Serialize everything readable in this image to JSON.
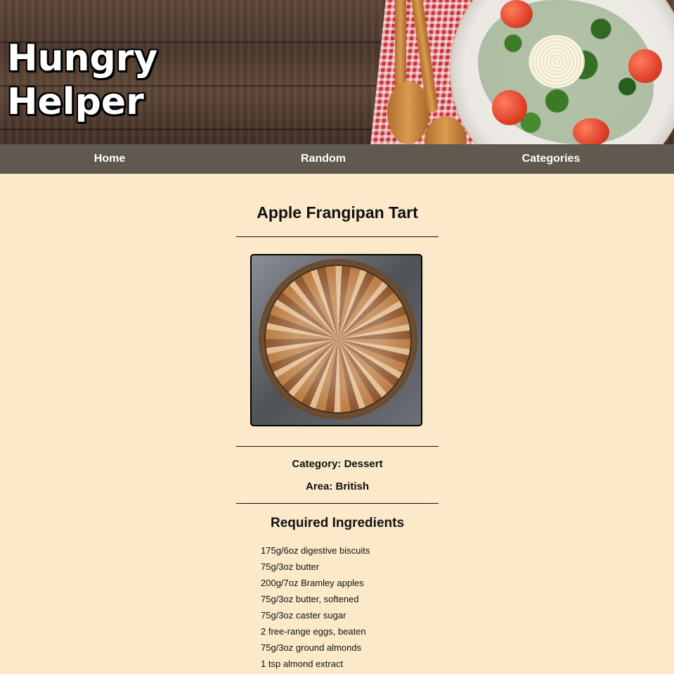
{
  "brand": {
    "line1": "Hungry",
    "line2": "Helper"
  },
  "nav": {
    "home": "Home",
    "random": "Random",
    "categories": "Categories"
  },
  "recipe": {
    "title": "Apple Frangipan Tart",
    "image_alt": "Apple Frangipan Tart",
    "category_text": "Category: Dessert",
    "area_text": "Area: British",
    "ingredients_heading": "Required Ingredients",
    "ingredients": [
      "175g/6oz digestive biscuits",
      "75g/3oz butter",
      "200g/7oz Bramley apples",
      "75g/3oz butter, softened",
      "75g/3oz caster sugar",
      "2 free-range eggs, beaten",
      "75g/3oz ground almonds",
      "1 tsp almond extract"
    ]
  },
  "colors": {
    "page_background": "#fbe9c9",
    "nav_background": "#5f594f",
    "text": "#111111",
    "nav_text": "#ffffff"
  }
}
